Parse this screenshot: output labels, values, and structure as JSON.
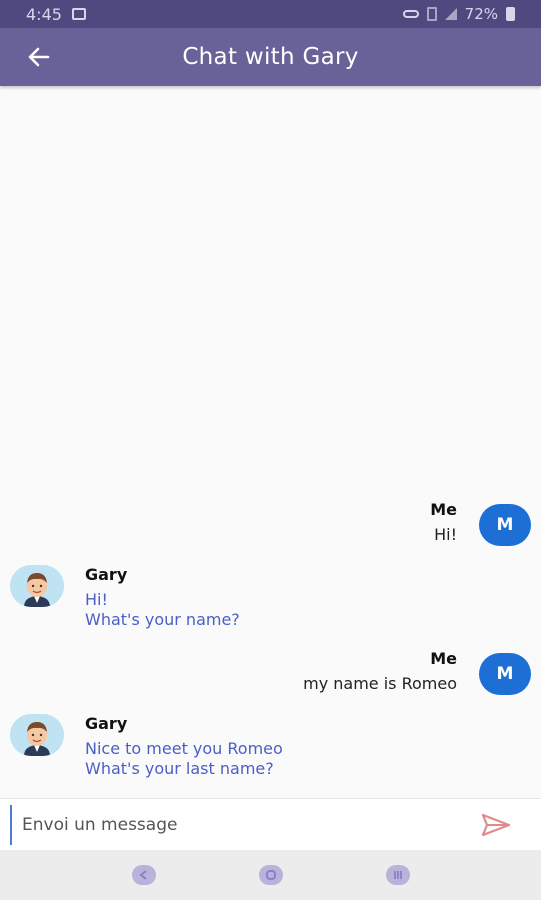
{
  "status_bar": {
    "time": "4:45",
    "battery": "72%"
  },
  "app_bar": {
    "title": "Chat with Gary"
  },
  "messages": [
    {
      "sender": "Me",
      "avatar_letter": "M",
      "lines": [
        "Hi!"
      ]
    },
    {
      "sender": "Gary",
      "lines": [
        "Hi!",
        "What's your name?"
      ]
    },
    {
      "sender": "Me",
      "avatar_letter": "M",
      "lines": [
        "my name is Romeo"
      ]
    },
    {
      "sender": "Gary",
      "lines": [
        "Nice to meet you Romeo",
        "What's  your last name?"
      ]
    }
  ],
  "composer": {
    "placeholder": "Envoi un message"
  },
  "icons": {
    "back": "arrow-left-icon",
    "send": "send-icon",
    "nav": [
      "nav-back-icon",
      "nav-home-icon",
      "nav-recents-icon"
    ]
  },
  "colors": {
    "app_bar": "#686299",
    "status_bar": "#4e4a80",
    "me_avatar": "#1d6fd6",
    "gary_text": "#4a5fc8",
    "send": "#e08a8a"
  }
}
